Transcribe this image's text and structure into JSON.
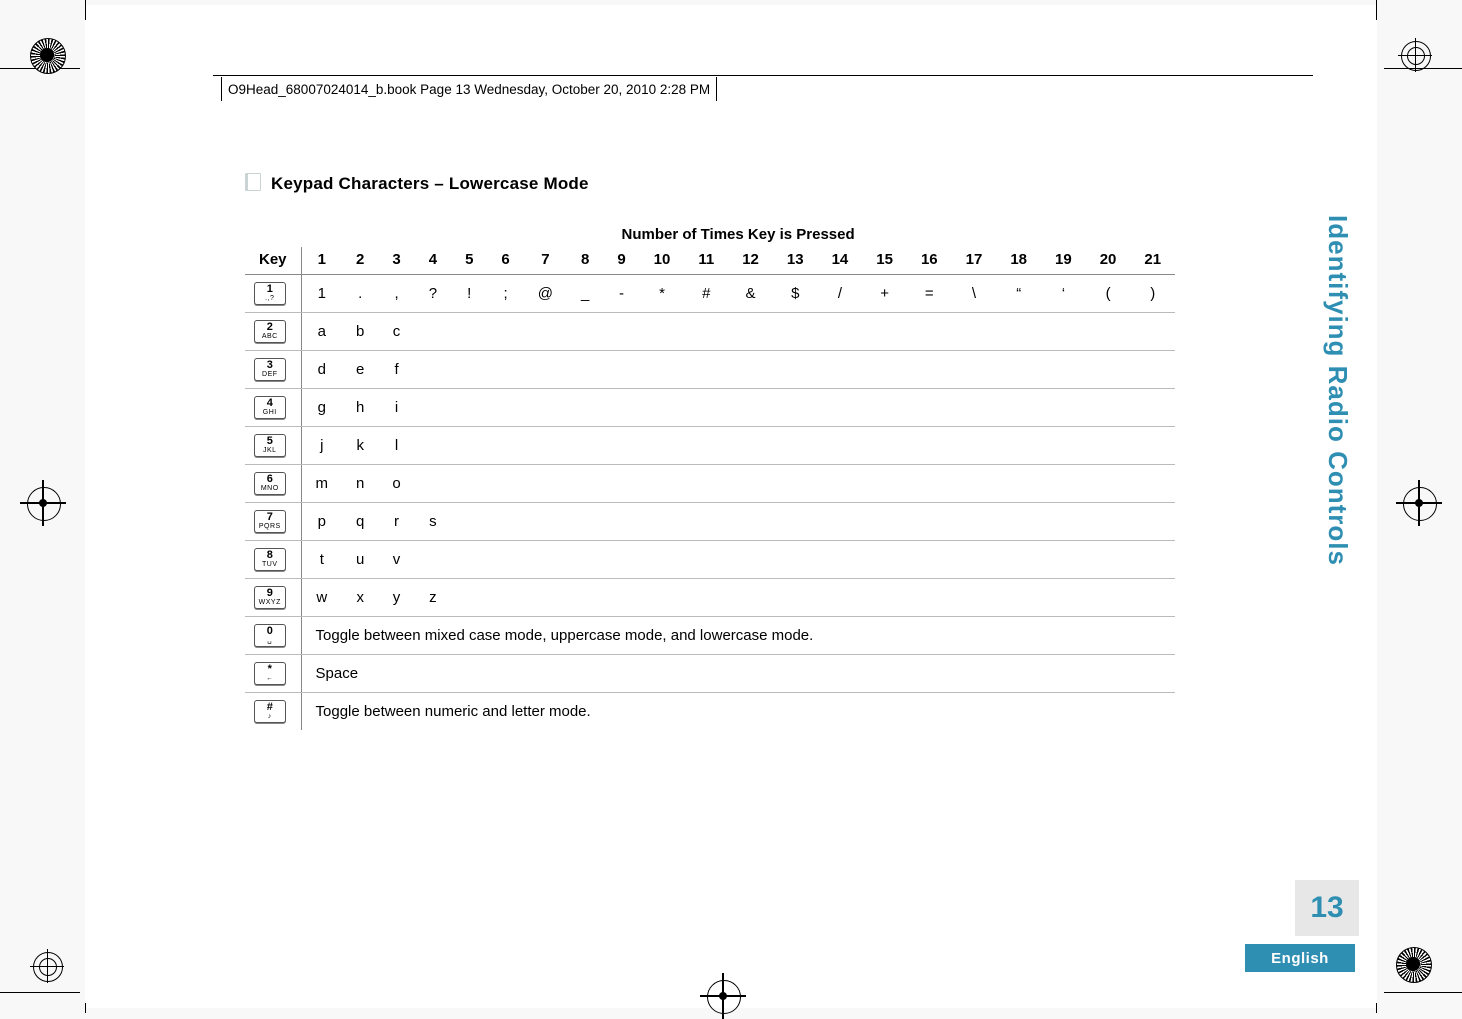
{
  "header_text": "O9Head_68007024014_b.book  Page 13  Wednesday, October 20, 2010  2:28 PM",
  "section_title": "Keypad Characters – Lowercase Mode",
  "table": {
    "group_header": "Number of Times Key is Pressed",
    "key_col_label": "Key",
    "columns": [
      "1",
      "2",
      "3",
      "4",
      "5",
      "6",
      "7",
      "8",
      "9",
      "10",
      "11",
      "12",
      "13",
      "14",
      "15",
      "16",
      "17",
      "18",
      "19",
      "20",
      "21"
    ],
    "rows": [
      {
        "key_big": "1",
        "key_small": ".,?",
        "cells": [
          "1",
          ".",
          ",",
          "?",
          "!",
          ";",
          "@",
          "_",
          "-",
          "*",
          "#",
          "&",
          "$",
          "/",
          "+",
          "=",
          "\\",
          "“",
          "‘",
          "(",
          ")"
        ]
      },
      {
        "key_big": "2",
        "key_small": "ABC",
        "cells": [
          "a",
          "b",
          "c",
          "",
          "",
          "",
          "",
          "",
          "",
          "",
          "",
          "",
          "",
          "",
          "",
          "",
          "",
          "",
          "",
          "",
          ""
        ]
      },
      {
        "key_big": "3",
        "key_small": "DEF",
        "cells": [
          "d",
          "e",
          "f",
          "",
          "",
          "",
          "",
          "",
          "",
          "",
          "",
          "",
          "",
          "",
          "",
          "",
          "",
          "",
          "",
          "",
          ""
        ]
      },
      {
        "key_big": "4",
        "key_small": "GHI",
        "cells": [
          "g",
          "h",
          "i",
          "",
          "",
          "",
          "",
          "",
          "",
          "",
          "",
          "",
          "",
          "",
          "",
          "",
          "",
          "",
          "",
          "",
          ""
        ]
      },
      {
        "key_big": "5",
        "key_small": "JKL",
        "cells": [
          "j",
          "k",
          "l",
          "",
          "",
          "",
          "",
          "",
          "",
          "",
          "",
          "",
          "",
          "",
          "",
          "",
          "",
          "",
          "",
          "",
          ""
        ]
      },
      {
        "key_big": "6",
        "key_small": "MNO",
        "cells": [
          "m",
          "n",
          "o",
          "",
          "",
          "",
          "",
          "",
          "",
          "",
          "",
          "",
          "",
          "",
          "",
          "",
          "",
          "",
          "",
          "",
          ""
        ]
      },
      {
        "key_big": "7",
        "key_small": "PQRS",
        "cells": [
          "p",
          "q",
          "r",
          "s",
          "",
          "",
          "",
          "",
          "",
          "",
          "",
          "",
          "",
          "",
          "",
          "",
          "",
          "",
          "",
          "",
          ""
        ]
      },
      {
        "key_big": "8",
        "key_small": "TUV",
        "cells": [
          "t",
          "u",
          "v",
          "",
          "",
          "",
          "",
          "",
          "",
          "",
          "",
          "",
          "",
          "",
          "",
          "",
          "",
          "",
          "",
          "",
          ""
        ]
      },
      {
        "key_big": "9",
        "key_small": "WXYZ",
        "cells": [
          "w",
          "x",
          "y",
          "z",
          "",
          "",
          "",
          "",
          "",
          "",
          "",
          "",
          "",
          "",
          "",
          "",
          "",
          "",
          "",
          "",
          ""
        ]
      },
      {
        "key_big": "0",
        "key_small": "␣",
        "span_text": "Toggle between mixed case mode, uppercase mode, and lowercase mode."
      },
      {
        "key_big": "*",
        "key_small": "←",
        "span_text": "Space"
      },
      {
        "key_big": "#",
        "key_small": "♪",
        "span_text": "Toggle between numeric and letter mode."
      }
    ]
  },
  "side_label": "Identifying Radio Controls",
  "page_number": "13",
  "language": "English",
  "chart_data": {
    "type": "table",
    "title": "Keypad Characters – Lowercase Mode",
    "xlabel": "Number of Times Key is Pressed",
    "ylabel": "Key",
    "columns": [
      "Key",
      "1",
      "2",
      "3",
      "4",
      "5",
      "6",
      "7",
      "8",
      "9",
      "10",
      "11",
      "12",
      "13",
      "14",
      "15",
      "16",
      "17",
      "18",
      "19",
      "20",
      "21"
    ],
    "rows": [
      [
        "1",
        "1",
        ".",
        ",",
        "?",
        "!",
        ";",
        "@",
        "_",
        "-",
        "*",
        "#",
        "&",
        "$",
        "/",
        "+",
        "=",
        "\\",
        "\"",
        "'",
        "(",
        ")"
      ],
      [
        "2",
        "a",
        "b",
        "c"
      ],
      [
        "3",
        "d",
        "e",
        "f"
      ],
      [
        "4",
        "g",
        "h",
        "i"
      ],
      [
        "5",
        "j",
        "k",
        "l"
      ],
      [
        "6",
        "m",
        "n",
        "o"
      ],
      [
        "7",
        "p",
        "q",
        "r",
        "s"
      ],
      [
        "8",
        "t",
        "u",
        "v"
      ],
      [
        "9",
        "w",
        "x",
        "y",
        "z"
      ],
      [
        "0",
        "Toggle between mixed case mode, uppercase mode, and lowercase mode."
      ],
      [
        "*",
        "Space"
      ],
      [
        "#",
        "Toggle between numeric and letter mode."
      ]
    ]
  }
}
